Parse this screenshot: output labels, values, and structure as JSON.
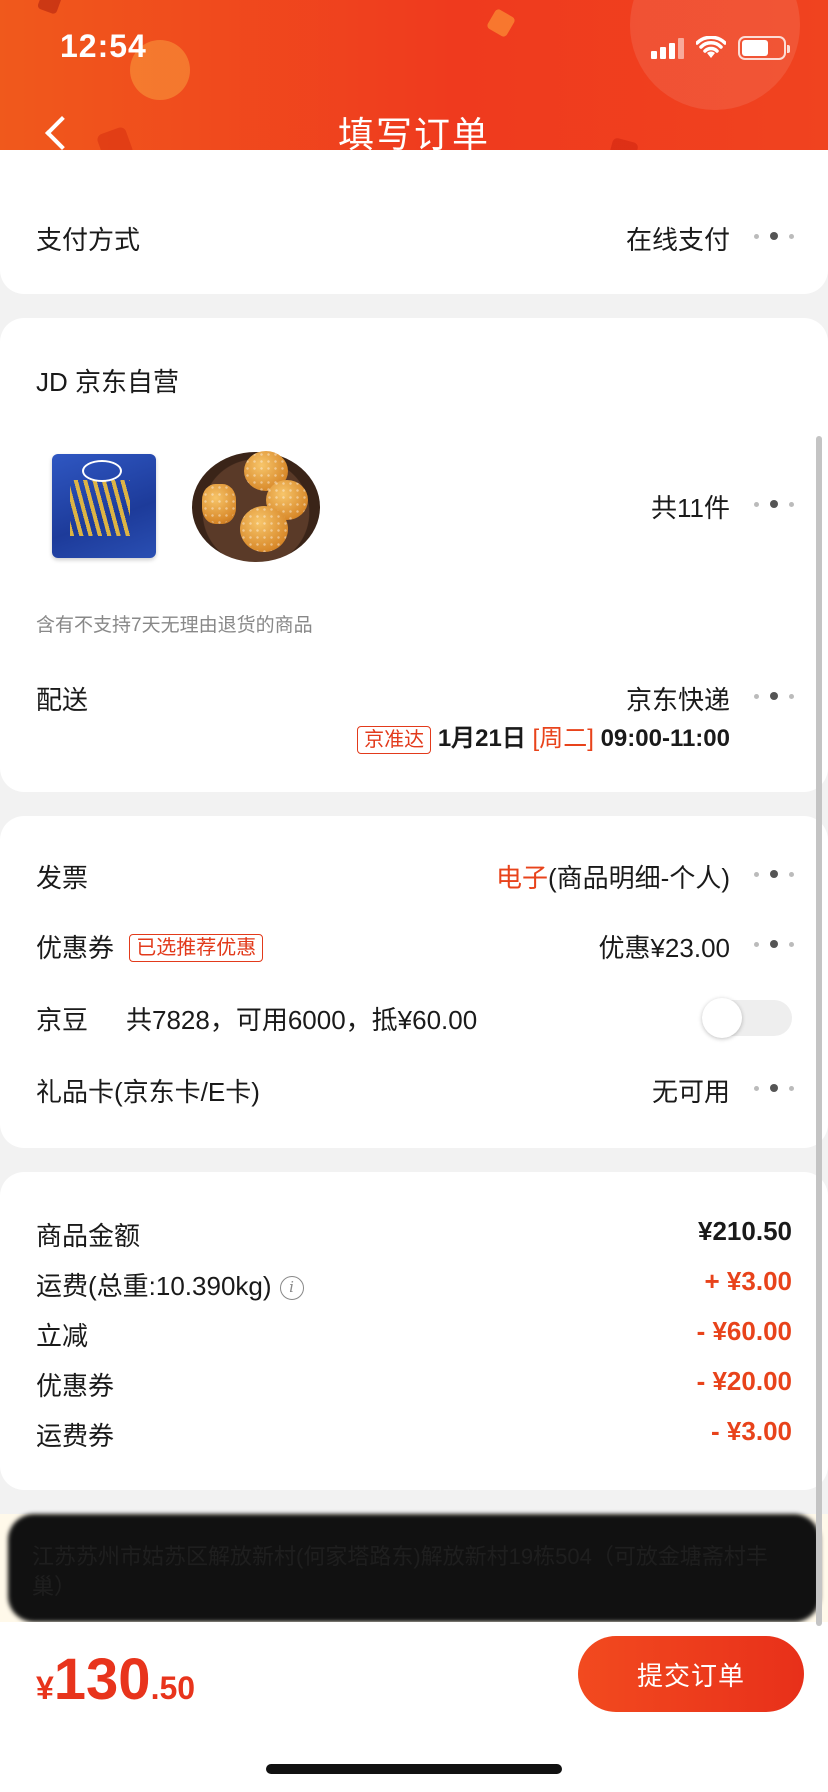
{
  "status_bar": {
    "time": "12:54"
  },
  "header": {
    "title": "填写订单"
  },
  "payment": {
    "label": "支付方式",
    "value": "在线支付"
  },
  "shop": {
    "name": "JD 京东自营",
    "item_count": "共11件",
    "return_notice": "含有不支持7天无理由退货的商品",
    "delivery_label": "配送",
    "delivery_carrier": "京东快递",
    "delivery_tag": "京准达",
    "delivery_date": "1月21日",
    "delivery_weekday": "[周二]",
    "delivery_time": "09:00-11:00"
  },
  "options": {
    "invoice_label": "发票",
    "invoice_type": "电子",
    "invoice_detail": "(商品明细-个人)",
    "coupon_label": "优惠券",
    "coupon_tag": "已选推荐优惠",
    "coupon_value": "优惠¥23.00",
    "beans_label": "京豆",
    "beans_detail": "共7828，可用6000，抵¥60.00",
    "giftcard_label": "礼品卡(京东卡/E卡)",
    "giftcard_value": "无可用"
  },
  "summary": {
    "rows": [
      {
        "label": "商品金额",
        "value": "¥210.50"
      },
      {
        "label": "运费(总重:10.390kg)",
        "value": "+ ¥3.00"
      },
      {
        "label": "立减",
        "value": "- ¥60.00"
      },
      {
        "label": "优惠券",
        "value": "- ¥20.00"
      },
      {
        "label": "运费券",
        "value": "- ¥3.00"
      }
    ]
  },
  "address": {
    "text": "江苏苏州市姑苏区解放新村(何家塔路东)解放新村19栋504（可放金塘斋村丰巢）"
  },
  "footer": {
    "currency": "¥",
    "total_int": "130",
    "total_dec": ".50",
    "submit_label": "提交订单"
  },
  "colors": {
    "accent": "#e8431b",
    "header_start": "#f0591c",
    "header_end": "#ef3a1e"
  }
}
